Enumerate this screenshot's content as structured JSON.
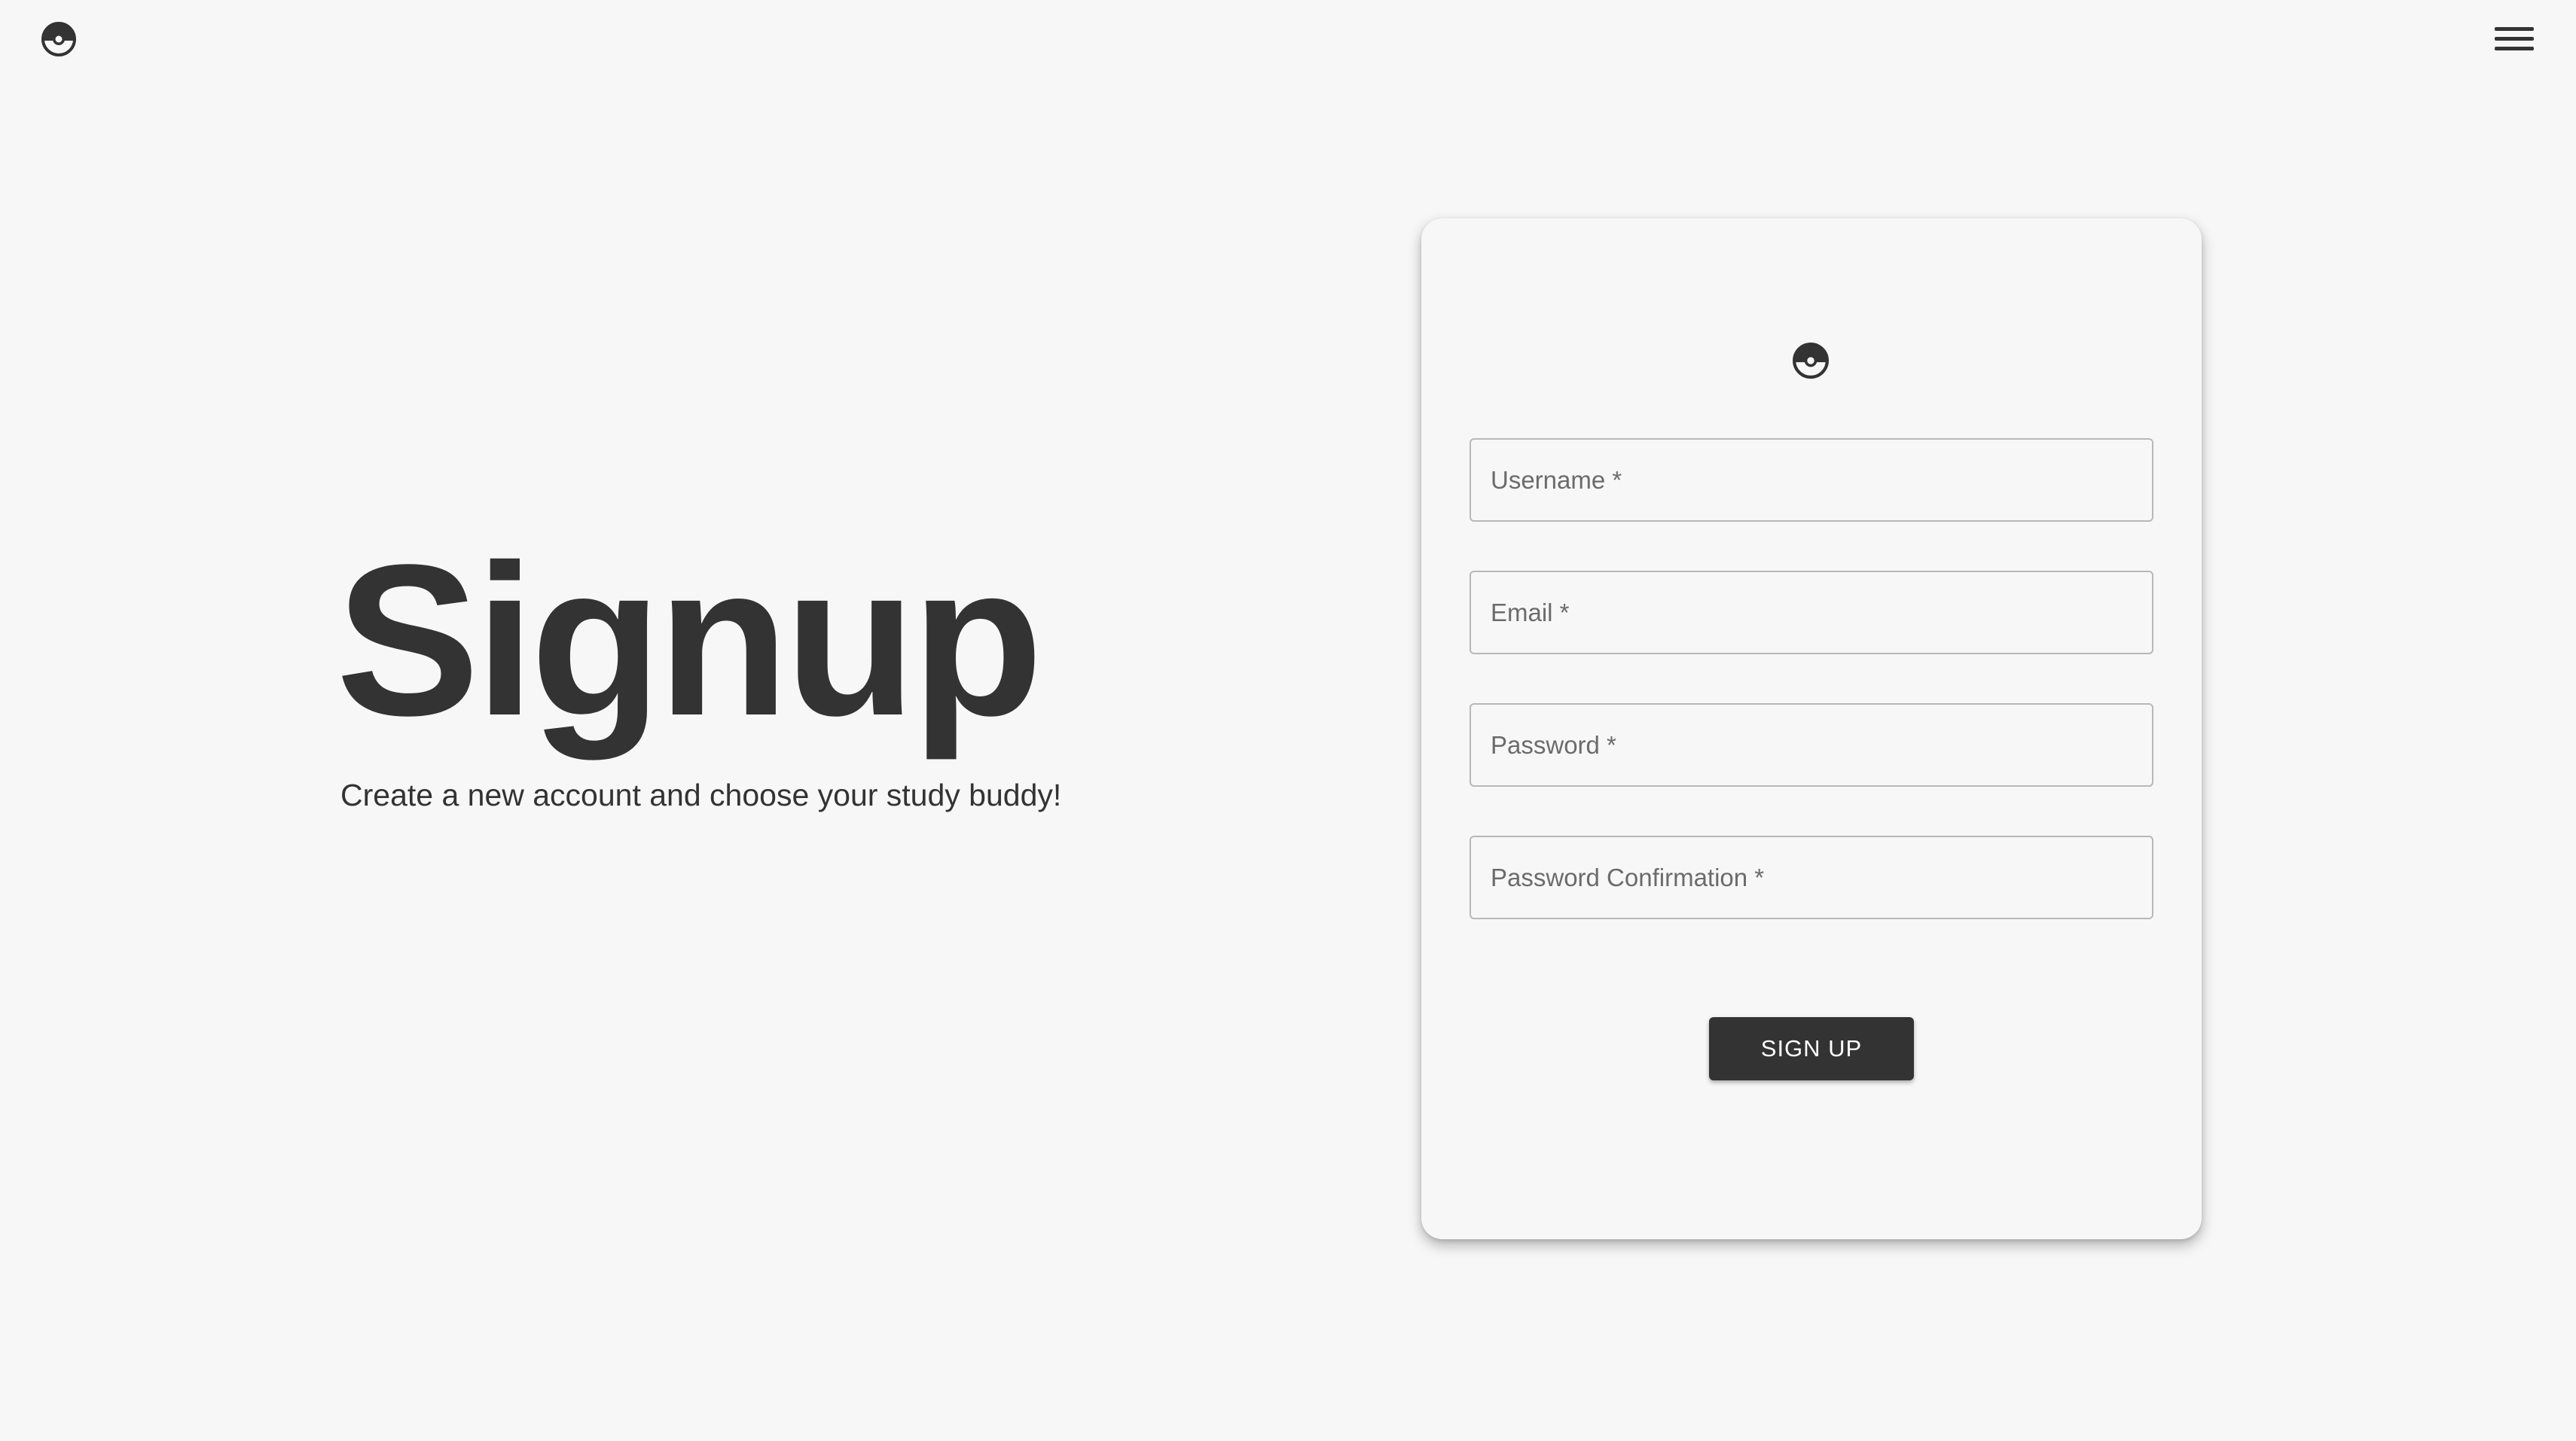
{
  "header": {
    "logo_icon": "pokeball-icon",
    "menu_icon": "hamburger-menu-icon"
  },
  "hero": {
    "title": "Signup",
    "subtitle": "Create a new account and choose your study buddy!"
  },
  "form": {
    "logo_icon": "pokeball-icon",
    "fields": [
      {
        "placeholder": "Username *",
        "value": ""
      },
      {
        "placeholder": "Email *",
        "value": ""
      },
      {
        "placeholder": "Password *",
        "value": ""
      },
      {
        "placeholder": "Password Confirmation *",
        "value": ""
      }
    ],
    "submit_label": "SIGN UP"
  },
  "colors": {
    "background": "#f7f7f7",
    "text": "#333333",
    "button_bg": "#333333",
    "button_text": "#ffffff",
    "field_border": "#b8b8b8"
  }
}
